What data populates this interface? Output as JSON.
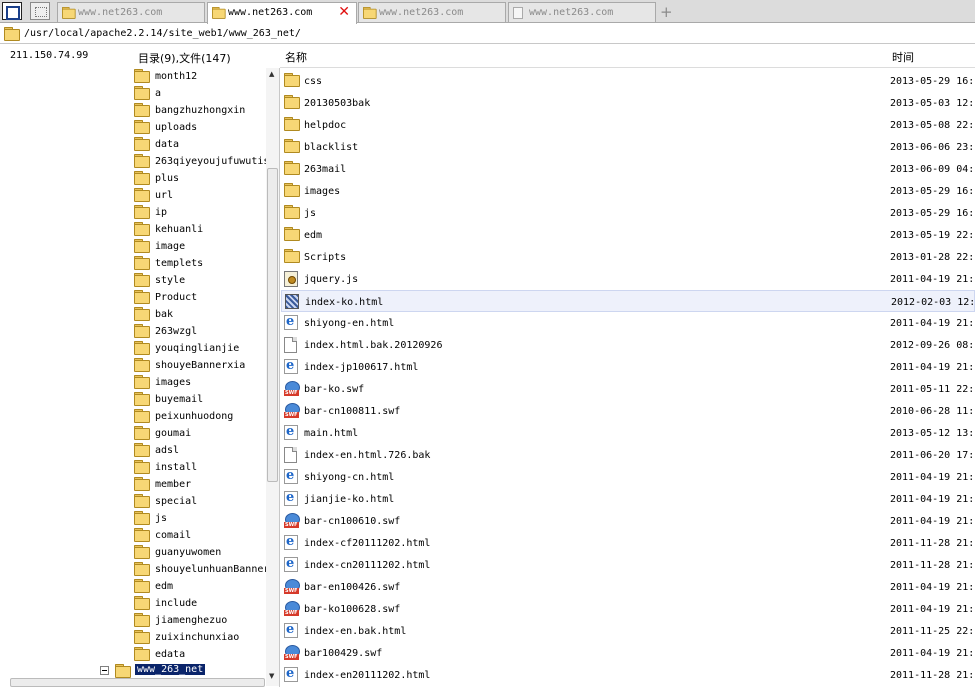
{
  "tabs": [
    {
      "label": "www.net263.com",
      "icon": "folder-icon",
      "active": false
    },
    {
      "label": "www.net263.com",
      "icon": "folder-icon",
      "active": true,
      "close": "✕"
    },
    {
      "label": "www.net263.com",
      "icon": "folder-icon",
      "active": false
    },
    {
      "label": "www.net263.com",
      "icon": "page-icon",
      "active": false
    }
  ],
  "tab_add": "+",
  "path": "/usr/local/apache2.2.14/site_web1/www_263_net/",
  "left_header": {
    "ip": "211.150.74.99",
    "dir_summary": "目录(9),文件(147)"
  },
  "columns": {
    "name": "名称",
    "time": "时间"
  },
  "tree": {
    "items": [
      "month12",
      "a",
      "bangzhuzhongxin",
      "uploads",
      "data",
      "263qiyeyoujufuwutis",
      "plus",
      "url",
      "ip",
      "kehuanli",
      "image",
      "templets",
      "style",
      "Product",
      "bak",
      "263wzgl",
      "youqinglianjie",
      "shouyeBannerxia",
      "images",
      "buyemail",
      "peixunhuodong",
      "goumai",
      "adsl",
      "install",
      "member",
      "special",
      "js",
      "comail",
      "guanyuwomen",
      "shouyelunhuanBanner",
      "edm",
      "include",
      "jiamenghezuo",
      "zuixinchunxiao",
      "edata"
    ],
    "selected_root": "www_263_net"
  },
  "files": [
    {
      "name": "css",
      "time": "2013-05-29 16:",
      "icon": "folder"
    },
    {
      "name": "20130503bak",
      "time": "2013-05-03 12:",
      "icon": "folder"
    },
    {
      "name": "helpdoc",
      "time": "2013-05-08 22:",
      "icon": "folder"
    },
    {
      "name": "blacklist",
      "time": "2013-06-06 23:",
      "icon": "folder"
    },
    {
      "name": "263mail",
      "time": "2013-06-09 04:",
      "icon": "folder"
    },
    {
      "name": "images",
      "time": "2013-05-29 16:",
      "icon": "folder"
    },
    {
      "name": "js",
      "time": "2013-05-29 16:",
      "icon": "folder"
    },
    {
      "name": "edm",
      "time": "2013-05-19 22:",
      "icon": "folder"
    },
    {
      "name": "Scripts",
      "time": "2013-01-28 22:",
      "icon": "folder"
    },
    {
      "name": "jquery.js",
      "time": "2011-04-19 21:",
      "icon": "js"
    },
    {
      "name": "index-ko.html",
      "time": "2012-02-03 12:",
      "icon": "pattern",
      "highlight": true
    },
    {
      "name": "shiyong-en.html",
      "time": "2011-04-19 21:",
      "icon": "ie"
    },
    {
      "name": "index.html.bak.20120926",
      "time": "2012-09-26 08:",
      "icon": "doc"
    },
    {
      "name": "index-jp100617.html",
      "time": "2011-04-19 21:",
      "icon": "ie"
    },
    {
      "name": "bar-ko.swf",
      "time": "2011-05-11 22:",
      "icon": "swf"
    },
    {
      "name": "bar-cn100811.swf",
      "time": "2010-06-28 11:",
      "icon": "swf"
    },
    {
      "name": "main.html",
      "time": "2013-05-12 13:",
      "icon": "ie"
    },
    {
      "name": "index-en.html.726.bak",
      "time": "2011-06-20 17:",
      "icon": "doc"
    },
    {
      "name": "shiyong-cn.html",
      "time": "2011-04-19 21:",
      "icon": "ie"
    },
    {
      "name": "jianjie-ko.html",
      "time": "2011-04-19 21:",
      "icon": "ie"
    },
    {
      "name": "bar-cn100610.swf",
      "time": "2011-04-19 21:",
      "icon": "swf"
    },
    {
      "name": "index-cf20111202.html",
      "time": "2011-11-28 21:",
      "icon": "ie"
    },
    {
      "name": "index-cn20111202.html",
      "time": "2011-11-28 21:",
      "icon": "ie"
    },
    {
      "name": "bar-en100426.swf",
      "time": "2011-04-19 21:",
      "icon": "swf"
    },
    {
      "name": "bar-ko100628.swf",
      "time": "2011-04-19 21:",
      "icon": "swf"
    },
    {
      "name": "index-en.bak.html",
      "time": "2011-11-25 22:",
      "icon": "ie"
    },
    {
      "name": "bar100429.swf",
      "time": "2011-04-19 21:",
      "icon": "swf"
    },
    {
      "name": "index-en20111202.html",
      "time": "2011-11-28 21:",
      "icon": "ie"
    }
  ],
  "scroll_arrows": {
    "up": "▲",
    "down": "▼"
  }
}
